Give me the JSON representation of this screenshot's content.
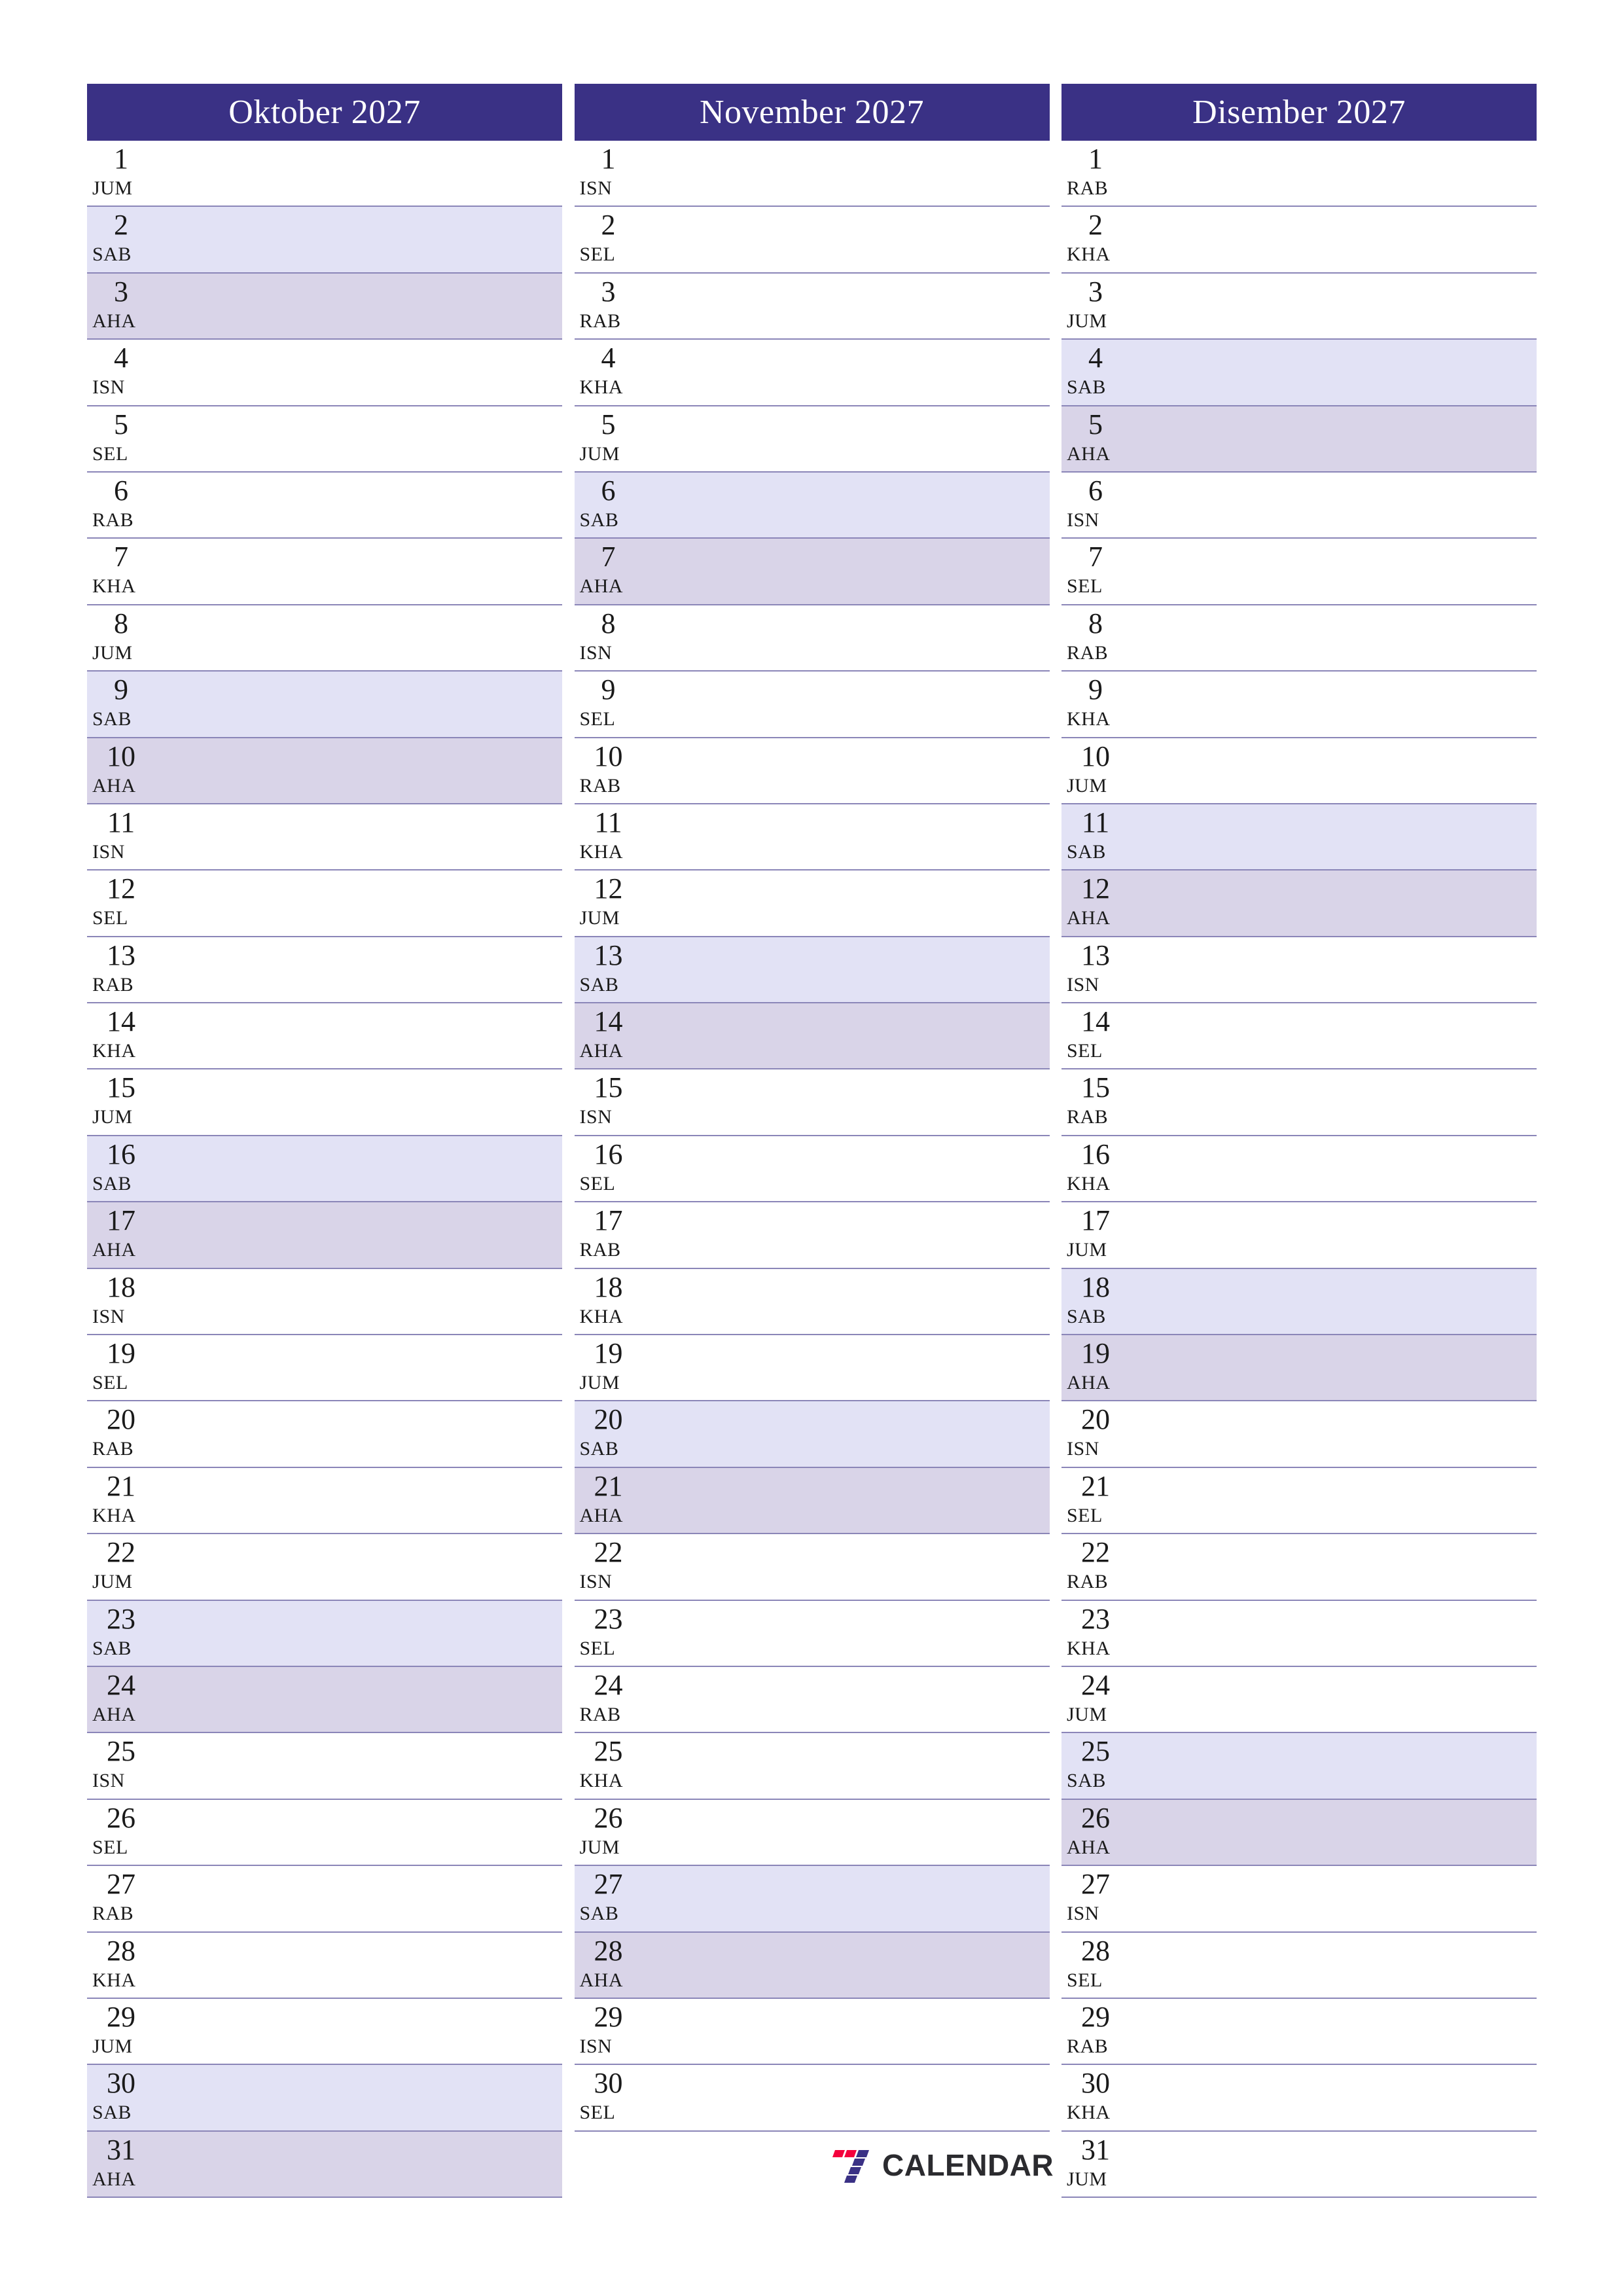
{
  "document": {
    "type": "quarterly-planner",
    "year": "2027",
    "language": "ms",
    "colors": {
      "header_bg": "#3a3185",
      "header_text": "#ffffff",
      "saturday_bg": "#e2e2f5",
      "sunday_bg": "#d9d4e8",
      "row_border": "#8b86b8",
      "day_text": "#1a1a1a"
    }
  },
  "brand": {
    "name": "CALENDAR",
    "mark_icon": "seven-logo-icon",
    "mark_colors": [
      "#f4003c",
      "#3a3185"
    ]
  },
  "months": [
    {
      "title": "Oktober 2027",
      "key": "oktober",
      "days": [
        {
          "num": "1",
          "dow": "JUM",
          "kind": "weekday"
        },
        {
          "num": "2",
          "dow": "SAB",
          "kind": "sat"
        },
        {
          "num": "3",
          "dow": "AHA",
          "kind": "sun"
        },
        {
          "num": "4",
          "dow": "ISN",
          "kind": "weekday"
        },
        {
          "num": "5",
          "dow": "SEL",
          "kind": "weekday"
        },
        {
          "num": "6",
          "dow": "RAB",
          "kind": "weekday"
        },
        {
          "num": "7",
          "dow": "KHA",
          "kind": "weekday"
        },
        {
          "num": "8",
          "dow": "JUM",
          "kind": "weekday"
        },
        {
          "num": "9",
          "dow": "SAB",
          "kind": "sat"
        },
        {
          "num": "10",
          "dow": "AHA",
          "kind": "sun"
        },
        {
          "num": "11",
          "dow": "ISN",
          "kind": "weekday"
        },
        {
          "num": "12",
          "dow": "SEL",
          "kind": "weekday"
        },
        {
          "num": "13",
          "dow": "RAB",
          "kind": "weekday"
        },
        {
          "num": "14",
          "dow": "KHA",
          "kind": "weekday"
        },
        {
          "num": "15",
          "dow": "JUM",
          "kind": "weekday"
        },
        {
          "num": "16",
          "dow": "SAB",
          "kind": "sat"
        },
        {
          "num": "17",
          "dow": "AHA",
          "kind": "sun"
        },
        {
          "num": "18",
          "dow": "ISN",
          "kind": "weekday"
        },
        {
          "num": "19",
          "dow": "SEL",
          "kind": "weekday"
        },
        {
          "num": "20",
          "dow": "RAB",
          "kind": "weekday"
        },
        {
          "num": "21",
          "dow": "KHA",
          "kind": "weekday"
        },
        {
          "num": "22",
          "dow": "JUM",
          "kind": "weekday"
        },
        {
          "num": "23",
          "dow": "SAB",
          "kind": "sat"
        },
        {
          "num": "24",
          "dow": "AHA",
          "kind": "sun"
        },
        {
          "num": "25",
          "dow": "ISN",
          "kind": "weekday"
        },
        {
          "num": "26",
          "dow": "SEL",
          "kind": "weekday"
        },
        {
          "num": "27",
          "dow": "RAB",
          "kind": "weekday"
        },
        {
          "num": "28",
          "dow": "KHA",
          "kind": "weekday"
        },
        {
          "num": "29",
          "dow": "JUM",
          "kind": "weekday"
        },
        {
          "num": "30",
          "dow": "SAB",
          "kind": "sat"
        },
        {
          "num": "31",
          "dow": "AHA",
          "kind": "sun"
        }
      ]
    },
    {
      "title": "November 2027",
      "key": "november",
      "days": [
        {
          "num": "1",
          "dow": "ISN",
          "kind": "weekday"
        },
        {
          "num": "2",
          "dow": "SEL",
          "kind": "weekday"
        },
        {
          "num": "3",
          "dow": "RAB",
          "kind": "weekday"
        },
        {
          "num": "4",
          "dow": "KHA",
          "kind": "weekday"
        },
        {
          "num": "5",
          "dow": "JUM",
          "kind": "weekday"
        },
        {
          "num": "6",
          "dow": "SAB",
          "kind": "sat"
        },
        {
          "num": "7",
          "dow": "AHA",
          "kind": "sun"
        },
        {
          "num": "8",
          "dow": "ISN",
          "kind": "weekday"
        },
        {
          "num": "9",
          "dow": "SEL",
          "kind": "weekday"
        },
        {
          "num": "10",
          "dow": "RAB",
          "kind": "weekday"
        },
        {
          "num": "11",
          "dow": "KHA",
          "kind": "weekday"
        },
        {
          "num": "12",
          "dow": "JUM",
          "kind": "weekday"
        },
        {
          "num": "13",
          "dow": "SAB",
          "kind": "sat"
        },
        {
          "num": "14",
          "dow": "AHA",
          "kind": "sun"
        },
        {
          "num": "15",
          "dow": "ISN",
          "kind": "weekday"
        },
        {
          "num": "16",
          "dow": "SEL",
          "kind": "weekday"
        },
        {
          "num": "17",
          "dow": "RAB",
          "kind": "weekday"
        },
        {
          "num": "18",
          "dow": "KHA",
          "kind": "weekday"
        },
        {
          "num": "19",
          "dow": "JUM",
          "kind": "weekday"
        },
        {
          "num": "20",
          "dow": "SAB",
          "kind": "sat"
        },
        {
          "num": "21",
          "dow": "AHA",
          "kind": "sun"
        },
        {
          "num": "22",
          "dow": "ISN",
          "kind": "weekday"
        },
        {
          "num": "23",
          "dow": "SEL",
          "kind": "weekday"
        },
        {
          "num": "24",
          "dow": "RAB",
          "kind": "weekday"
        },
        {
          "num": "25",
          "dow": "KHA",
          "kind": "weekday"
        },
        {
          "num": "26",
          "dow": "JUM",
          "kind": "weekday"
        },
        {
          "num": "27",
          "dow": "SAB",
          "kind": "sat"
        },
        {
          "num": "28",
          "dow": "AHA",
          "kind": "sun"
        },
        {
          "num": "29",
          "dow": "ISN",
          "kind": "weekday"
        },
        {
          "num": "30",
          "dow": "SEL",
          "kind": "weekday"
        }
      ]
    },
    {
      "title": "Disember 2027",
      "key": "disember",
      "days": [
        {
          "num": "1",
          "dow": "RAB",
          "kind": "weekday"
        },
        {
          "num": "2",
          "dow": "KHA",
          "kind": "weekday"
        },
        {
          "num": "3",
          "dow": "JUM",
          "kind": "weekday"
        },
        {
          "num": "4",
          "dow": "SAB",
          "kind": "sat"
        },
        {
          "num": "5",
          "dow": "AHA",
          "kind": "sun"
        },
        {
          "num": "6",
          "dow": "ISN",
          "kind": "weekday"
        },
        {
          "num": "7",
          "dow": "SEL",
          "kind": "weekday"
        },
        {
          "num": "8",
          "dow": "RAB",
          "kind": "weekday"
        },
        {
          "num": "9",
          "dow": "KHA",
          "kind": "weekday"
        },
        {
          "num": "10",
          "dow": "JUM",
          "kind": "weekday"
        },
        {
          "num": "11",
          "dow": "SAB",
          "kind": "sat"
        },
        {
          "num": "12",
          "dow": "AHA",
          "kind": "sun"
        },
        {
          "num": "13",
          "dow": "ISN",
          "kind": "weekday"
        },
        {
          "num": "14",
          "dow": "SEL",
          "kind": "weekday"
        },
        {
          "num": "15",
          "dow": "RAB",
          "kind": "weekday"
        },
        {
          "num": "16",
          "dow": "KHA",
          "kind": "weekday"
        },
        {
          "num": "17",
          "dow": "JUM",
          "kind": "weekday"
        },
        {
          "num": "18",
          "dow": "SAB",
          "kind": "sat"
        },
        {
          "num": "19",
          "dow": "AHA",
          "kind": "sun"
        },
        {
          "num": "20",
          "dow": "ISN",
          "kind": "weekday"
        },
        {
          "num": "21",
          "dow": "SEL",
          "kind": "weekday"
        },
        {
          "num": "22",
          "dow": "RAB",
          "kind": "weekday"
        },
        {
          "num": "23",
          "dow": "KHA",
          "kind": "weekday"
        },
        {
          "num": "24",
          "dow": "JUM",
          "kind": "weekday"
        },
        {
          "num": "25",
          "dow": "SAB",
          "kind": "sat"
        },
        {
          "num": "26",
          "dow": "AHA",
          "kind": "sun"
        },
        {
          "num": "27",
          "dow": "ISN",
          "kind": "weekday"
        },
        {
          "num": "28",
          "dow": "SEL",
          "kind": "weekday"
        },
        {
          "num": "29",
          "dow": "RAB",
          "kind": "weekday"
        },
        {
          "num": "30",
          "dow": "KHA",
          "kind": "weekday"
        },
        {
          "num": "31",
          "dow": "JUM",
          "kind": "weekday"
        }
      ]
    }
  ]
}
